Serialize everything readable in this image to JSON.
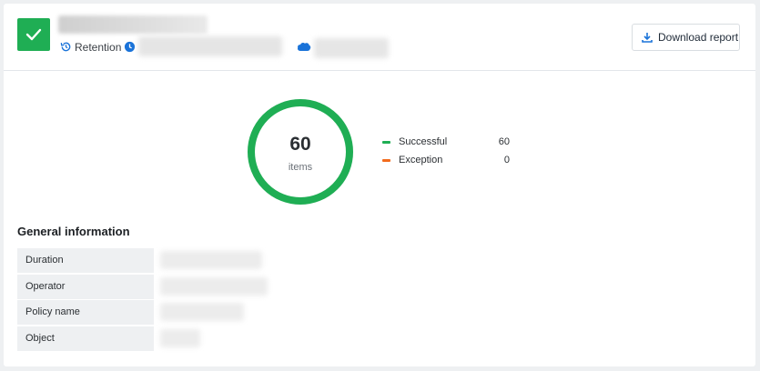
{
  "header": {
    "retention_label": "Retention",
    "download_label": "Download report"
  },
  "summary": {
    "total": "60",
    "unit": "items",
    "successful_fraction": 1.0
  },
  "legend": [
    {
      "label": "Successful",
      "value": "60",
      "color": "#1fae54"
    },
    {
      "label": "Exception",
      "value": "0",
      "color": "#f26b1d"
    }
  ],
  "general": {
    "title": "General information",
    "rows": [
      {
        "key": "Duration"
      },
      {
        "key": "Operator"
      },
      {
        "key": "Policy name"
      },
      {
        "key": "Object"
      }
    ]
  },
  "colors": {
    "success": "#1fae54",
    "exception": "#f26b1d",
    "accent": "#1a73d9"
  }
}
